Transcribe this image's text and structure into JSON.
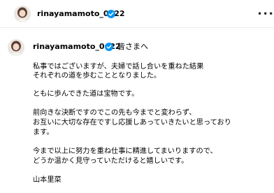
{
  "header": {
    "username": "rinayamamoto_0622",
    "avatar_icon": "profile-photo-avatar",
    "verified_icon": "verified-badge-icon",
    "menu_icon": "more-options-icon"
  },
  "post": {
    "username": "rinayamamoto_0622",
    "greeting": "皆さまへ",
    "lines": [
      "私事ではございますが、夫婦で話し合いを重ねた結果",
      "それぞれの道を歩むこととなりました。",
      "",
      "ともに歩んできた道は宝物です。",
      "",
      "前向きな決断ですのでこの先も今までと変わらず、",
      "お互いに大切な存在ですし応援しあっていきたいと思っており",
      "ます。",
      "",
      "今まで以上に努力を重ね仕事に精進してまいりますので、",
      "どうか温かく見守っていただけると嬉しいです。",
      "",
      "山本里菜"
    ]
  },
  "colors": {
    "verified_blue": "#0095f6",
    "divider": "#ededed"
  }
}
